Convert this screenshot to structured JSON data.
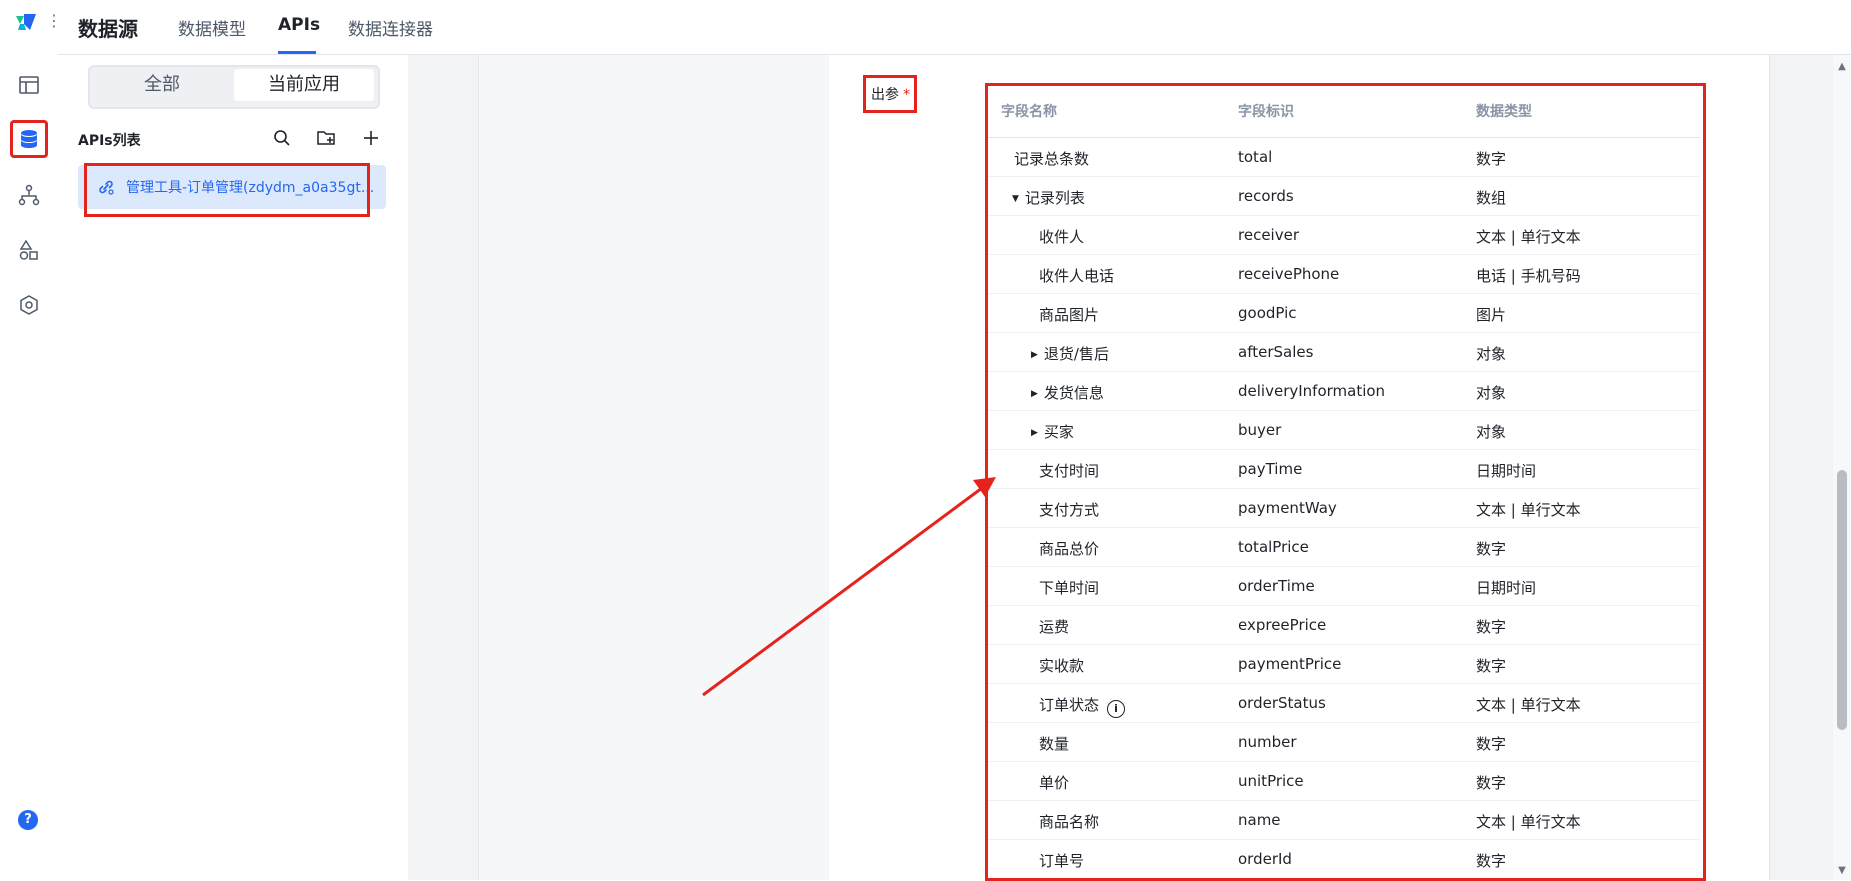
{
  "nav": {
    "app_title": "数据源",
    "tabs": [
      {
        "label": "数据模型"
      },
      {
        "label": "APIs"
      },
      {
        "label": "数据连接器"
      }
    ]
  },
  "rail": {
    "icons": [
      "layout-icon",
      "database-icon",
      "flow-icon",
      "shapes-icon",
      "settings-hexagon-icon"
    ],
    "help_glyph": "?"
  },
  "panel": {
    "segment": {
      "all": "全部",
      "current": "当前应用"
    },
    "list_title": "APIs列表",
    "items": [
      {
        "label": "管理工具-订单管理(zdydm_a0a35gt..."
      }
    ]
  },
  "output_params": {
    "label": "出参",
    "required_mark": "*",
    "headers": {
      "name": "字段名称",
      "key": "字段标识",
      "type": "数据类型"
    },
    "rows": [
      {
        "name": "记录总条数",
        "key": "total",
        "type": "数字"
      },
      {
        "name": "记录列表",
        "key": "records",
        "type": "数组"
      },
      {
        "name": "收件人",
        "key": "receiver",
        "type": "文本 | 单行文本"
      },
      {
        "name": "收件人电话",
        "key": "receivePhone",
        "type": "电话 | 手机号码"
      },
      {
        "name": "商品图片",
        "key": "goodPic",
        "type": "图片"
      },
      {
        "name": "退货/售后",
        "key": "afterSales",
        "type": "对象"
      },
      {
        "name": "发货信息",
        "key": "deliveryInformation",
        "type": "对象"
      },
      {
        "name": "买家",
        "key": "buyer",
        "type": "对象"
      },
      {
        "name": "支付时间",
        "key": "payTime",
        "type": "日期时间"
      },
      {
        "name": "支付方式",
        "key": "paymentWay",
        "type": "文本 | 单行文本"
      },
      {
        "name": "商品总价",
        "key": "totalPrice",
        "type": "数字"
      },
      {
        "name": "下单时间",
        "key": "orderTime",
        "type": "日期时间"
      },
      {
        "name": "运费",
        "key": "expreePrice",
        "type": "数字"
      },
      {
        "name": "实收款",
        "key": "paymentPrice",
        "type": "数字"
      },
      {
        "name": "订单状态",
        "key": "orderStatus",
        "type": "文本 | 单行文本"
      },
      {
        "name": "数量",
        "key": "number",
        "type": "数字"
      },
      {
        "name": "单价",
        "key": "unitPrice",
        "type": "数字"
      },
      {
        "name": "商品名称",
        "key": "name",
        "type": "文本 | 单行文本"
      },
      {
        "name": "订单号",
        "key": "orderId",
        "type": "数字"
      }
    ]
  },
  "colors": {
    "accent": "#2468f2",
    "highlight": "#e5231d"
  }
}
